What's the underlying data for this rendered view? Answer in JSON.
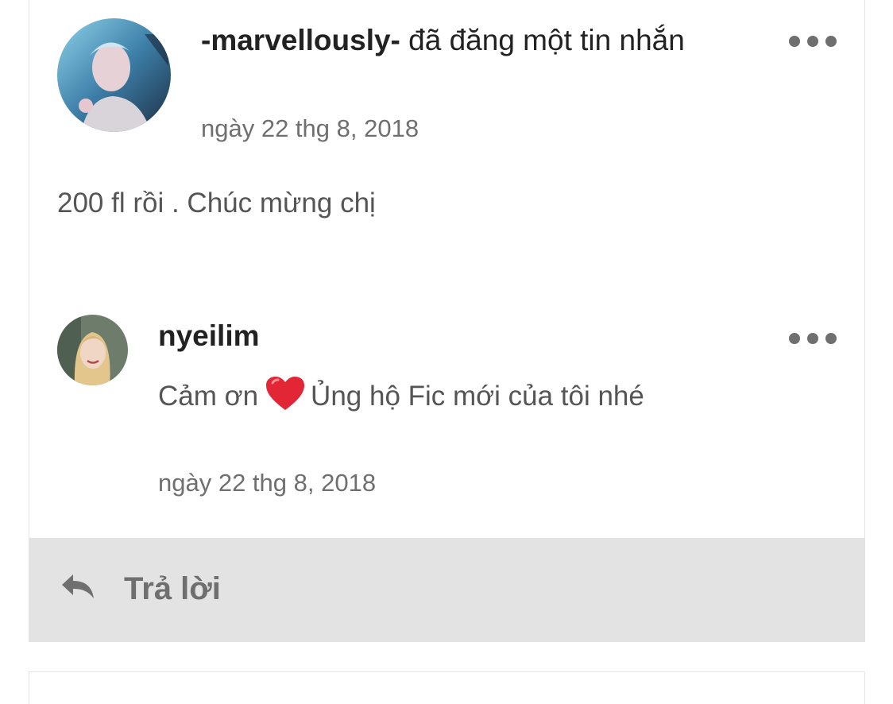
{
  "post": {
    "username": "-marvellously-",
    "action": "đã đăng một tin nhắn",
    "timestamp": "ngày 22 thg 8, 2018",
    "message": "200 fl rồi . Chúc mừng chị"
  },
  "reply": {
    "username": "nyeilim",
    "text_before": "Cảm ơn",
    "text_after": "Ủng hộ Fic mới của tôi nhé",
    "emoji": "red-heart",
    "timestamp": "ngày 22 thg 8, 2018"
  },
  "reply_action": {
    "label": "Trả lời",
    "icon": "reply-arrow-icon"
  },
  "colors": {
    "reply_bar_bg": "#e3e3e3",
    "muted_text": "#6f6f6f",
    "heart": "#e32636"
  }
}
